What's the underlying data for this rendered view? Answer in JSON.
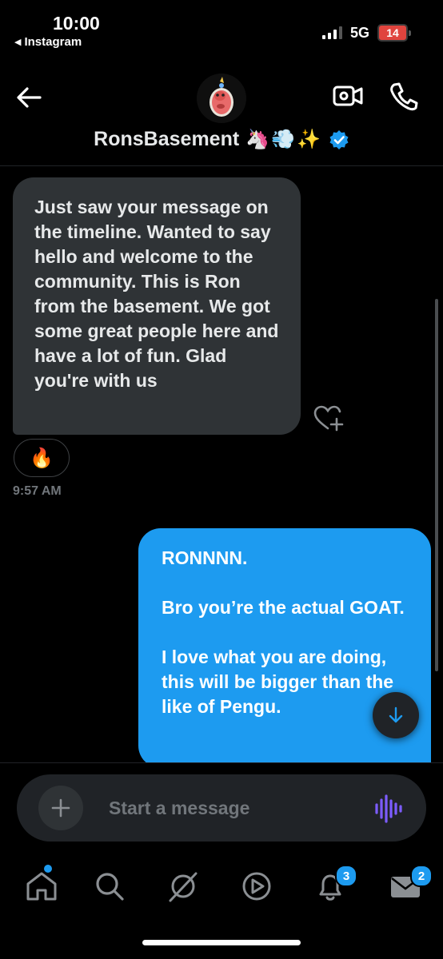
{
  "status_bar": {
    "time": "10:00",
    "back_app": "Instagram",
    "network": "5G",
    "battery": "14"
  },
  "header": {
    "contact_name": "RonsBasement",
    "name_emojis": "🦄💨✨",
    "verified": true
  },
  "messages": [
    {
      "direction": "incoming",
      "text": "Just saw your message on the timeline. Wanted to say hello and welcome to the community. This is Ron from the basement. We got some great people here and have a lot of fun. Glad you're with us",
      "reaction": "🔥",
      "time": "9:57 AM"
    },
    {
      "direction": "outgoing",
      "text": "RONNNN.\n\nBro you’re the actual GOAT.\n\nI love what you are doing, this will be bigger than the like of Pengu."
    }
  ],
  "composer": {
    "placeholder": "Start a message"
  },
  "tab_bar": {
    "items": [
      {
        "name": "home",
        "badge": ""
      },
      {
        "name": "search",
        "badge": ""
      },
      {
        "name": "grok",
        "badge": ""
      },
      {
        "name": "video",
        "badge": ""
      },
      {
        "name": "notifications",
        "badge": "3"
      },
      {
        "name": "messages",
        "badge": "2"
      }
    ]
  },
  "colors": {
    "accent": "#1d9bf0",
    "incoming_bubble": "#2f3336",
    "background": "#000000",
    "battery_low": "#e0443e",
    "voice_icon": "#7c5cff"
  }
}
